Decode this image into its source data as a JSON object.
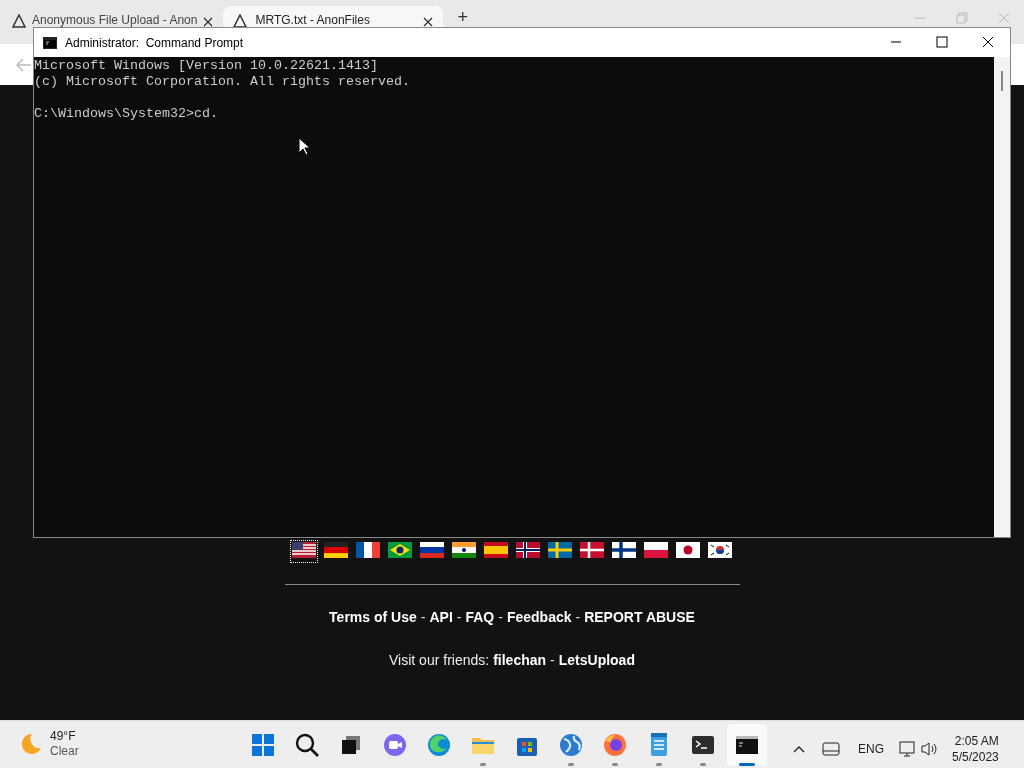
{
  "browser": {
    "tabs": [
      {
        "title": "Anonymous File Upload - Anon",
        "selected": false
      },
      {
        "title": "MRTG.txt - AnonFiles",
        "selected": true
      }
    ],
    "new_tab": "+"
  },
  "page": {
    "flags": [
      {
        "selected": true
      },
      {
        "selected": false
      },
      {
        "selected": false
      },
      {
        "selected": false
      },
      {
        "selected": false
      },
      {
        "selected": false
      },
      {
        "selected": false
      },
      {
        "selected": false
      },
      {
        "selected": false
      },
      {
        "selected": false
      },
      {
        "selected": false
      },
      {
        "selected": false
      },
      {
        "selected": false
      },
      {
        "selected": false
      }
    ],
    "footer_links": [
      {
        "label": "Terms of Use"
      },
      {
        "separator": "-",
        "label": "API"
      },
      {
        "separator": "-",
        "label": "FAQ"
      },
      {
        "separator": "-",
        "label": "Feedback"
      },
      {
        "separator": "-",
        "label": "REPORT ABUSE"
      }
    ],
    "friends": {
      "text": "Visit our friends:",
      "links": [
        {
          "label": "filechan"
        },
        {
          "separator": "-",
          "label": "LetsUpload"
        }
      ]
    }
  },
  "console": {
    "title": "Administrator:  Command Prompt",
    "paragraphs": [
      {
        "lines": [
          "Microsoft Windows [Version 10.0.22621.1413]",
          "(c) Microsoft Corporation. All rights reserved."
        ]
      },
      {
        "lines": [
          "C:\\Windows\\System32>cd."
        ]
      }
    ]
  },
  "taskbar": {
    "weather": {
      "temperature": "49°F",
      "condition": "Clear"
    },
    "apps": [
      {
        "kind": "start",
        "running": false,
        "active": false
      },
      {
        "kind": "search",
        "running": false,
        "active": false
      },
      {
        "kind": "taskview",
        "running": false,
        "active": false
      },
      {
        "kind": "chat",
        "running": false,
        "active": false
      },
      {
        "kind": "edge",
        "running": false,
        "active": false
      },
      {
        "kind": "folder",
        "running": true,
        "active": false
      },
      {
        "kind": "store",
        "running": false,
        "active": false
      },
      {
        "kind": "globe",
        "running": true,
        "active": false
      },
      {
        "kind": "firefox",
        "running": true,
        "active": false
      },
      {
        "kind": "notepad",
        "running": true,
        "active": false
      },
      {
        "kind": "terminal",
        "running": true,
        "active": false
      },
      {
        "kind": "cmd",
        "running": true,
        "active": true
      }
    ],
    "language": "ENG",
    "time": "2:05 AM",
    "date": "5/5/2023"
  }
}
